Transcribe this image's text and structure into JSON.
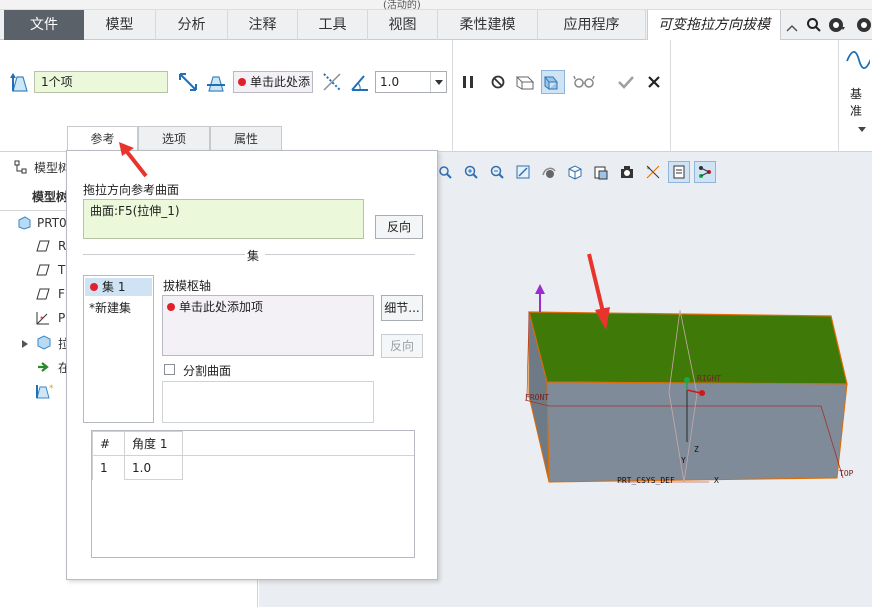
{
  "window": {
    "title_fragment": "(活动的)"
  },
  "menu": [
    {
      "label": "文件"
    },
    {
      "label": "模型"
    },
    {
      "label": "分析"
    },
    {
      "label": "注释"
    },
    {
      "label": "工具"
    },
    {
      "label": "视图"
    },
    {
      "label": "柔性建模"
    },
    {
      "label": "应用程序"
    },
    {
      "label": "可变拖拉方向拔模"
    }
  ],
  "ribbon": {
    "pull_reference_value": "1个项",
    "hinge_value": "单击此处添",
    "angle_value": "1.0",
    "datum_label": "基准"
  },
  "tabs": [
    {
      "label": "参考"
    },
    {
      "label": "选项"
    },
    {
      "label": "属性"
    }
  ],
  "model_tree": {
    "header_label": "模型树",
    "sub_label": "模型树",
    "root_label": "PRT0",
    "items": [
      {
        "label": "R"
      },
      {
        "label": "T("
      },
      {
        "label": "FI"
      },
      {
        "label": "PI"
      },
      {
        "label": "拉"
      },
      {
        "label": "在"
      }
    ]
  },
  "references_panel": {
    "surface_label": "拖拉方向参考曲面",
    "surface_value": "曲面:F5(拉伸_1)",
    "flip_label": "反向",
    "set_section_label": "集",
    "sets": [
      {
        "label": "集 1"
      },
      {
        "label": "*新建集"
      }
    ],
    "hinge_label": "拔模枢轴",
    "hinge_value": "单击此处添加项",
    "details_label": "细节...",
    "flip2_label": "反向",
    "split_label": "分割曲面",
    "table_headers": [
      "#",
      "角度 1"
    ],
    "table_rows": [
      [
        "1",
        "1.0"
      ]
    ]
  },
  "viewport": {
    "labels": {
      "front": "FRONT",
      "right": "RIGHT",
      "top": "TOP",
      "csys": "PRT_CSYS_DEF",
      "x": "X",
      "y": "Y",
      "z": "Z"
    },
    "colors": {
      "top_face": "#3f7a08",
      "body": "#7f8b99",
      "edge": "#e06a00",
      "arrow": "#e8342d"
    }
  }
}
